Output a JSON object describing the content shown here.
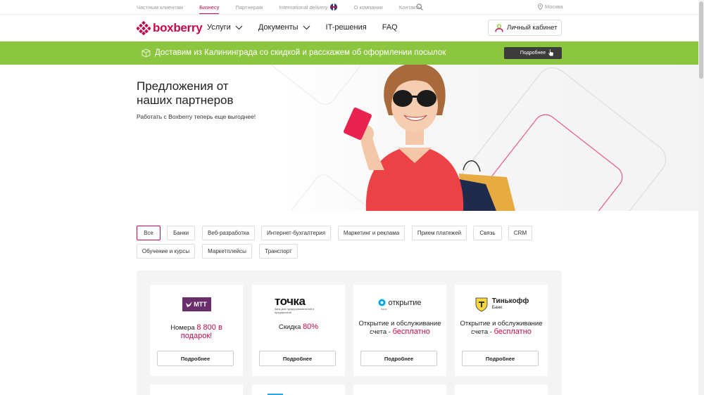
{
  "topnav": {
    "items": [
      "Частным клиентам",
      "Бизнесу",
      "Партнерам",
      "International delivery",
      "О компании",
      "Контакты"
    ],
    "city": "Москва"
  },
  "header": {
    "logo": "boxberry",
    "nav": [
      "Услуги",
      "Документы",
      "IT-решения",
      "FAQ"
    ],
    "cabinet": "Личный кабинет"
  },
  "banner": {
    "text": "Доставим из Калининграда со скидкой и расскажем об оформлении посылок",
    "button": "Подробнее"
  },
  "hero": {
    "title_line1": "Предложения от",
    "title_line2": "наших партнеров",
    "subtitle": "Работать с Boxberry теперь еще выгоднее!"
  },
  "filters": [
    "Все",
    "Банки",
    "Веб-разработка",
    "Интернет-бухгалтерия",
    "Маркетинг и реклама",
    "Прием платежей",
    "Связь",
    "CRM",
    "Обучение и курсы",
    "Маркетплейсы",
    "Транспорт"
  ],
  "cards": [
    {
      "logo": "МТТ",
      "text": "Номера",
      "highlight": "8 800 в подарок!",
      "button": "Подробнее"
    },
    {
      "logo": "точка",
      "logo_sub": "банк для предпринимателей и предприятий",
      "text": "Скидка",
      "highlight": "80%",
      "button": "Подробнее"
    },
    {
      "logo": "открытие",
      "logo_sub": "банк",
      "text": "Открытие и обслуживание счета -",
      "highlight": "бесплатно",
      "button": "Подробнее"
    },
    {
      "logo": "Тинькофф",
      "logo_sub": "Банк",
      "text": "Открытие и обслуживание счета -",
      "highlight": "бесплатно",
      "button": "Подробнее"
    }
  ],
  "colors": {
    "brand": "#c6094b",
    "banner": "#8cc63f",
    "dark_button": "#3c3c3c"
  }
}
